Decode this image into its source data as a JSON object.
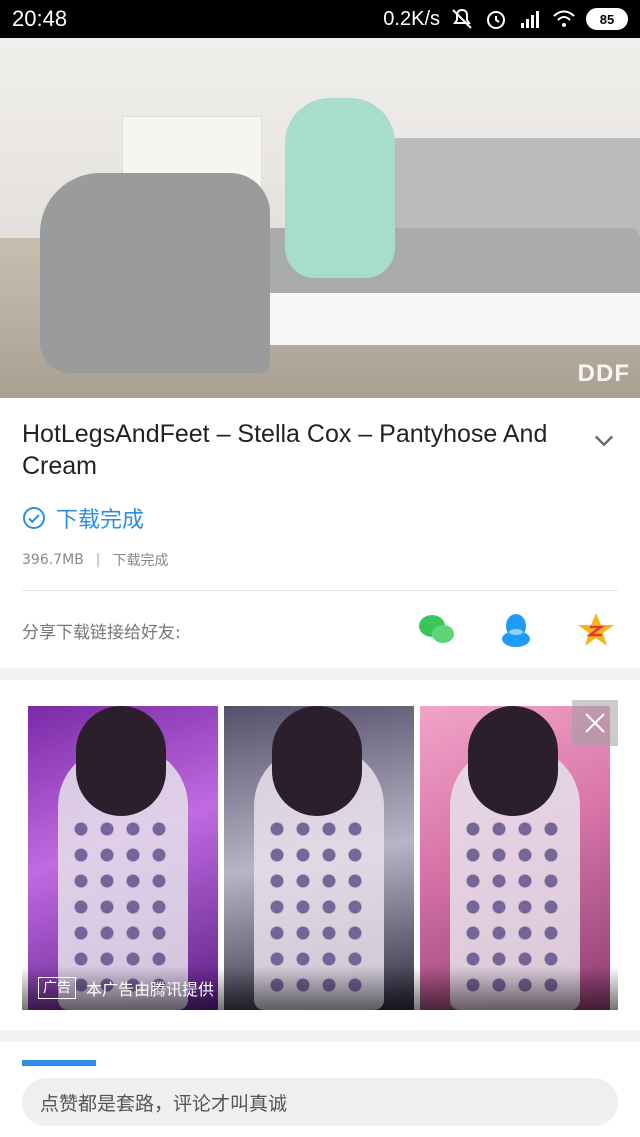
{
  "status_bar": {
    "time": "20:48",
    "net_speed": "0.2K/s",
    "battery": "85"
  },
  "video": {
    "hero_logo": "DDF",
    "title": "HotLegsAndFeet – Stella Cox – Pantyhose And Cream",
    "download_status": "下载完成",
    "size": "396.7MB",
    "meta_status": "下载完成"
  },
  "share": {
    "label": "分享下载链接给好友:",
    "targets": [
      "wechat-icon",
      "qq-icon",
      "qzone-icon"
    ]
  },
  "ad": {
    "badge": "广告",
    "caption": "本广告由腾讯提供"
  },
  "comment": {
    "placeholder": "点赞都是套路，评论才叫真诚"
  },
  "colors": {
    "accent": "#2b8de6",
    "wechat": "#3ac55a",
    "qq": "#1e9cf3",
    "qzone": "#f7b616"
  }
}
